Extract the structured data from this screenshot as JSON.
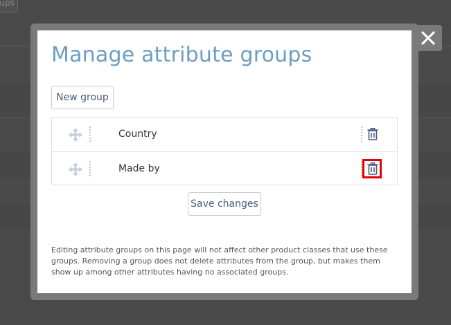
{
  "background": {
    "button_fragment": "ups"
  },
  "modal": {
    "title": "Manage attribute groups",
    "new_group_label": "New group",
    "save_label": "Save changes",
    "groups": [
      {
        "name": "Country"
      },
      {
        "name": "Made by"
      }
    ],
    "help_text": "Editing attribute groups on this page will not affect other product classes that use these groups. Removing a group does not delete attributes from the group, but makes them show up among other attributes having no associated groups."
  },
  "icons": {
    "close": "close-icon",
    "drag": "move-icon",
    "delete": "trash-icon"
  },
  "colors": {
    "title": "#6d9ec2",
    "button_text": "#4a5a80",
    "highlight": "#e00000",
    "overlay": "#4a4a4a"
  }
}
